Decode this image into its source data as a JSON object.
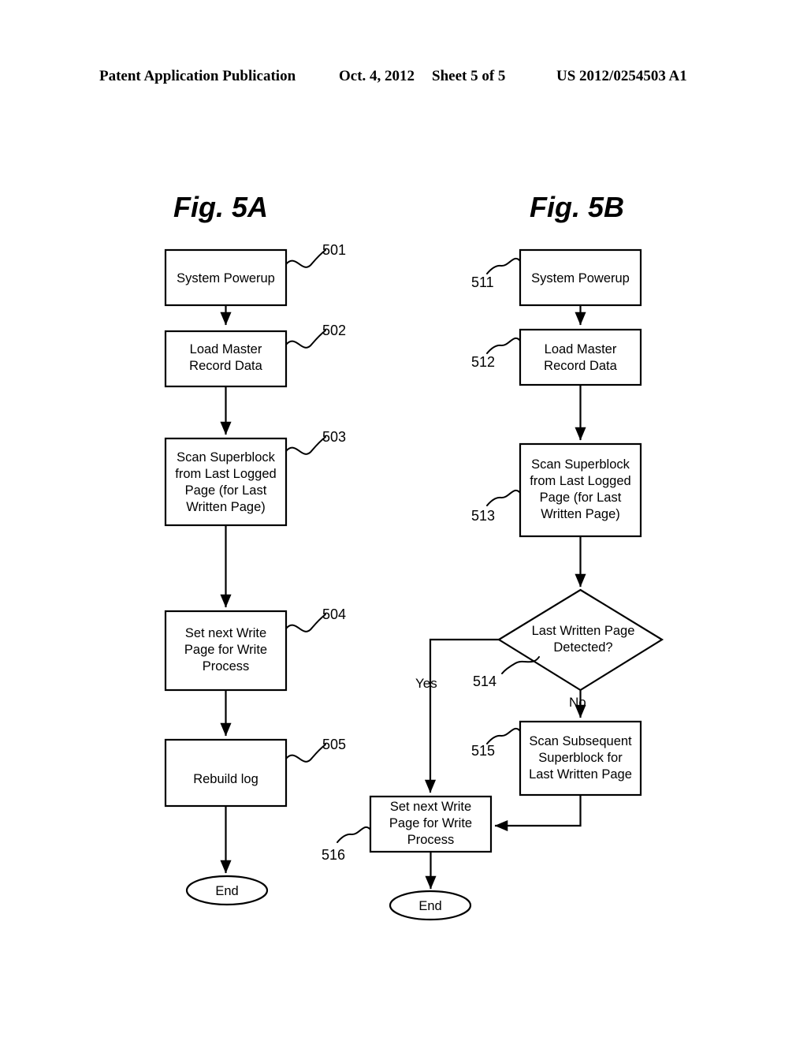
{
  "header": {
    "publication": "Patent Application Publication",
    "date": "Oct. 4, 2012",
    "sheet": "Sheet 5 of 5",
    "number": "US 2012/0254503 A1"
  },
  "figures": [
    {
      "id": "fig-5a",
      "title": "Fig. 5A",
      "nodes": [
        {
          "ref": "501",
          "shape": "box",
          "lines": [
            "System Powerup"
          ]
        },
        {
          "ref": "502",
          "shape": "box",
          "lines": [
            "Load Master",
            "Record Data"
          ]
        },
        {
          "ref": "503",
          "shape": "box",
          "lines": [
            "Scan Superblock",
            "from Last Logged",
            "Page (for Last",
            "Written Page)"
          ]
        },
        {
          "ref": "504",
          "shape": "box",
          "lines": [
            "Set next Write",
            "Page for Write",
            "Process"
          ]
        },
        {
          "ref": "505",
          "shape": "box",
          "lines": [
            "Rebuild log"
          ]
        },
        {
          "ref": "",
          "shape": "ellipse",
          "lines": [
            "End"
          ]
        }
      ]
    },
    {
      "id": "fig-5b",
      "title": "Fig. 5B",
      "nodes": [
        {
          "ref": "511",
          "shape": "box",
          "lines": [
            "System Powerup"
          ]
        },
        {
          "ref": "512",
          "shape": "box",
          "lines": [
            "Load Master",
            "Record Data"
          ]
        },
        {
          "ref": "513",
          "shape": "box",
          "lines": [
            "Scan Superblock",
            "from Last Logged",
            "Page (for Last",
            "Written Page)"
          ]
        },
        {
          "ref": "514",
          "shape": "diamond",
          "lines": [
            "Last Written Page",
            "Detected?"
          ]
        },
        {
          "ref": "515",
          "shape": "box",
          "lines": [
            "Scan Subsequent",
            "Superblock for",
            "Last Written Page"
          ]
        },
        {
          "ref": "516",
          "shape": "box",
          "lines": [
            "Set next Write",
            "Page for Write",
            "Process"
          ]
        },
        {
          "ref": "",
          "shape": "ellipse",
          "lines": [
            "End"
          ]
        }
      ],
      "edge_labels": {
        "yes": "Yes",
        "no": "No"
      }
    }
  ],
  "text": {
    "fig5a_title": "Fig. 5A",
    "fig5b_title": "Fig. 5B",
    "system_powerup": "System Powerup",
    "load_master_1": "Load Master",
    "load_master_2": "Record Data",
    "scan_sb_1": "Scan Superblock",
    "scan_sb_2": "from Last Logged",
    "scan_sb_3": "Page (for Last",
    "scan_sb_4": "Written Page)",
    "set_next_1": "Set next Write",
    "set_next_2": "Page for Write",
    "set_next_3": "Process",
    "rebuild_log": "Rebuild log",
    "end": "End",
    "diamond_1": "Last Written Page",
    "diamond_2": "Detected?",
    "scan_sub_1": "Scan Subsequent",
    "scan_sub_2": "Superblock for",
    "scan_sub_3": "Last Written Page",
    "yes": "Yes",
    "no": "No",
    "ref_501": "501",
    "ref_502": "502",
    "ref_503": "503",
    "ref_504": "504",
    "ref_505": "505",
    "ref_511": "511",
    "ref_512": "512",
    "ref_513": "513",
    "ref_514": "514",
    "ref_515": "515",
    "ref_516": "516"
  },
  "colors": {
    "ink": "#000000",
    "paper": "#ffffff"
  }
}
